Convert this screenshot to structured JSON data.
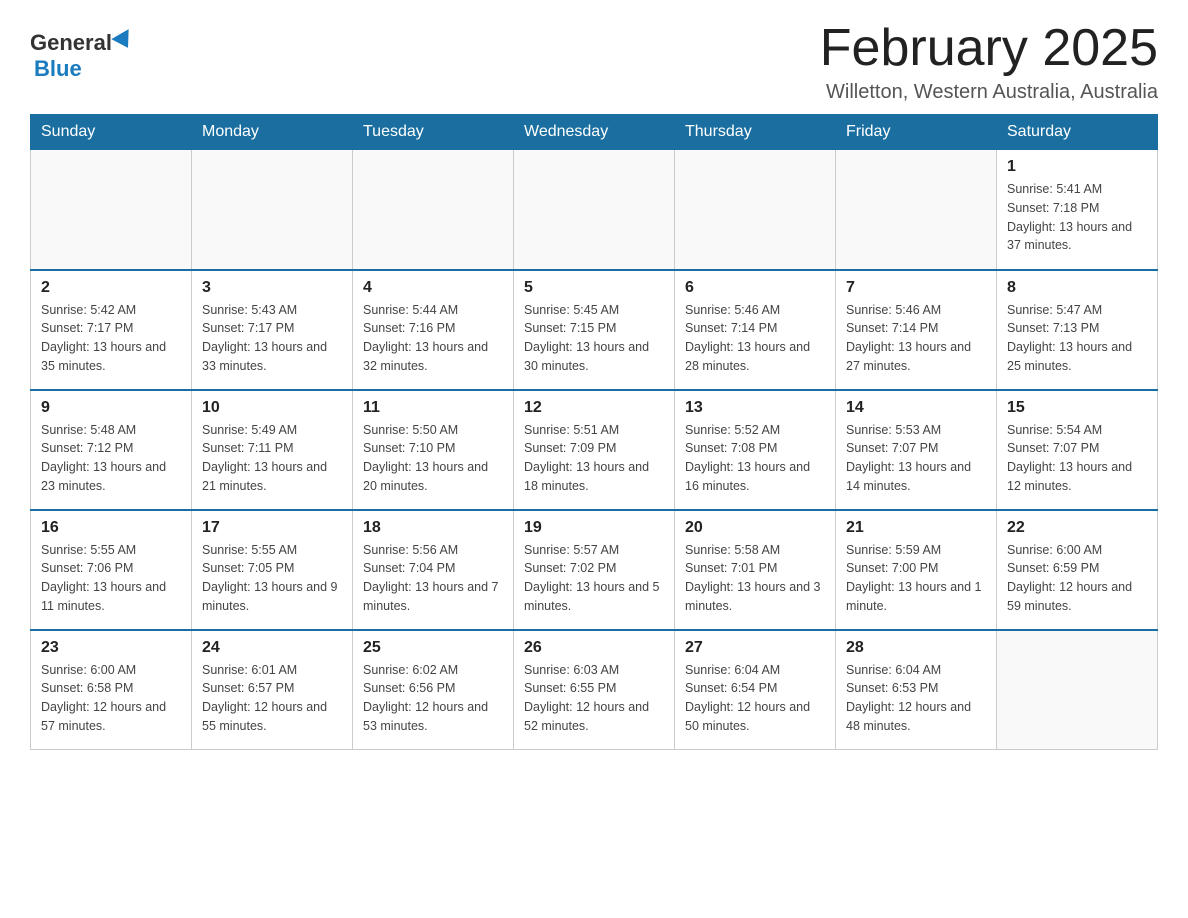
{
  "header": {
    "logo": {
      "general": "General",
      "blue": "Blue"
    },
    "title": "February 2025",
    "location": "Willetton, Western Australia, Australia"
  },
  "days_of_week": [
    "Sunday",
    "Monday",
    "Tuesday",
    "Wednesday",
    "Thursday",
    "Friday",
    "Saturday"
  ],
  "weeks": [
    [
      {
        "day": "",
        "info": ""
      },
      {
        "day": "",
        "info": ""
      },
      {
        "day": "",
        "info": ""
      },
      {
        "day": "",
        "info": ""
      },
      {
        "day": "",
        "info": ""
      },
      {
        "day": "",
        "info": ""
      },
      {
        "day": "1",
        "info": "Sunrise: 5:41 AM\nSunset: 7:18 PM\nDaylight: 13 hours and 37 minutes."
      }
    ],
    [
      {
        "day": "2",
        "info": "Sunrise: 5:42 AM\nSunset: 7:17 PM\nDaylight: 13 hours and 35 minutes."
      },
      {
        "day": "3",
        "info": "Sunrise: 5:43 AM\nSunset: 7:17 PM\nDaylight: 13 hours and 33 minutes."
      },
      {
        "day": "4",
        "info": "Sunrise: 5:44 AM\nSunset: 7:16 PM\nDaylight: 13 hours and 32 minutes."
      },
      {
        "day": "5",
        "info": "Sunrise: 5:45 AM\nSunset: 7:15 PM\nDaylight: 13 hours and 30 minutes."
      },
      {
        "day": "6",
        "info": "Sunrise: 5:46 AM\nSunset: 7:14 PM\nDaylight: 13 hours and 28 minutes."
      },
      {
        "day": "7",
        "info": "Sunrise: 5:46 AM\nSunset: 7:14 PM\nDaylight: 13 hours and 27 minutes."
      },
      {
        "day": "8",
        "info": "Sunrise: 5:47 AM\nSunset: 7:13 PM\nDaylight: 13 hours and 25 minutes."
      }
    ],
    [
      {
        "day": "9",
        "info": "Sunrise: 5:48 AM\nSunset: 7:12 PM\nDaylight: 13 hours and 23 minutes."
      },
      {
        "day": "10",
        "info": "Sunrise: 5:49 AM\nSunset: 7:11 PM\nDaylight: 13 hours and 21 minutes."
      },
      {
        "day": "11",
        "info": "Sunrise: 5:50 AM\nSunset: 7:10 PM\nDaylight: 13 hours and 20 minutes."
      },
      {
        "day": "12",
        "info": "Sunrise: 5:51 AM\nSunset: 7:09 PM\nDaylight: 13 hours and 18 minutes."
      },
      {
        "day": "13",
        "info": "Sunrise: 5:52 AM\nSunset: 7:08 PM\nDaylight: 13 hours and 16 minutes."
      },
      {
        "day": "14",
        "info": "Sunrise: 5:53 AM\nSunset: 7:07 PM\nDaylight: 13 hours and 14 minutes."
      },
      {
        "day": "15",
        "info": "Sunrise: 5:54 AM\nSunset: 7:07 PM\nDaylight: 13 hours and 12 minutes."
      }
    ],
    [
      {
        "day": "16",
        "info": "Sunrise: 5:55 AM\nSunset: 7:06 PM\nDaylight: 13 hours and 11 minutes."
      },
      {
        "day": "17",
        "info": "Sunrise: 5:55 AM\nSunset: 7:05 PM\nDaylight: 13 hours and 9 minutes."
      },
      {
        "day": "18",
        "info": "Sunrise: 5:56 AM\nSunset: 7:04 PM\nDaylight: 13 hours and 7 minutes."
      },
      {
        "day": "19",
        "info": "Sunrise: 5:57 AM\nSunset: 7:02 PM\nDaylight: 13 hours and 5 minutes."
      },
      {
        "day": "20",
        "info": "Sunrise: 5:58 AM\nSunset: 7:01 PM\nDaylight: 13 hours and 3 minutes."
      },
      {
        "day": "21",
        "info": "Sunrise: 5:59 AM\nSunset: 7:00 PM\nDaylight: 13 hours and 1 minute."
      },
      {
        "day": "22",
        "info": "Sunrise: 6:00 AM\nSunset: 6:59 PM\nDaylight: 12 hours and 59 minutes."
      }
    ],
    [
      {
        "day": "23",
        "info": "Sunrise: 6:00 AM\nSunset: 6:58 PM\nDaylight: 12 hours and 57 minutes."
      },
      {
        "day": "24",
        "info": "Sunrise: 6:01 AM\nSunset: 6:57 PM\nDaylight: 12 hours and 55 minutes."
      },
      {
        "day": "25",
        "info": "Sunrise: 6:02 AM\nSunset: 6:56 PM\nDaylight: 12 hours and 53 minutes."
      },
      {
        "day": "26",
        "info": "Sunrise: 6:03 AM\nSunset: 6:55 PM\nDaylight: 12 hours and 52 minutes."
      },
      {
        "day": "27",
        "info": "Sunrise: 6:04 AM\nSunset: 6:54 PM\nDaylight: 12 hours and 50 minutes."
      },
      {
        "day": "28",
        "info": "Sunrise: 6:04 AM\nSunset: 6:53 PM\nDaylight: 12 hours and 48 minutes."
      },
      {
        "day": "",
        "info": ""
      }
    ]
  ]
}
